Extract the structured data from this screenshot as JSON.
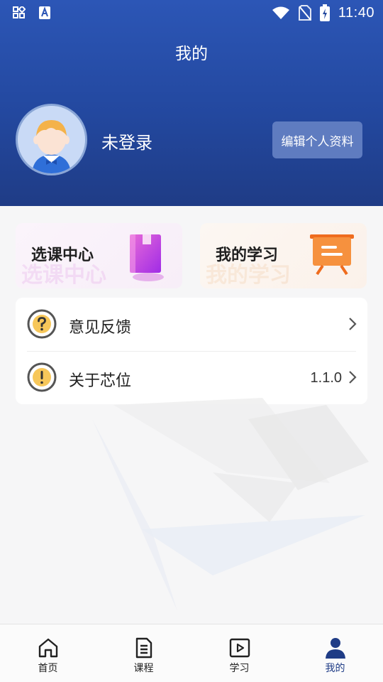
{
  "status_bar": {
    "time": "11:40",
    "left_icons": [
      "grid-icon",
      "a-app-icon"
    ],
    "right_icons": [
      "wifi-icon",
      "no-sim-icon",
      "battery-charging-icon"
    ]
  },
  "header": {
    "title": "我的",
    "background_color": "#23489f"
  },
  "profile": {
    "username": "未登录",
    "edit_button_label": "编辑个人资料"
  },
  "quick_cards": [
    {
      "label": "选课中心",
      "icon": "book-icon",
      "accent": "#c63ed3"
    },
    {
      "label": "我的学习",
      "icon": "presentation-board-icon",
      "accent": "#f07a2a"
    }
  ],
  "menu": {
    "items": [
      {
        "label": "意见反馈",
        "icon": "question-circle-icon",
        "value": ""
      },
      {
        "label": "关于芯位",
        "icon": "exclamation-circle-icon",
        "value": "1.1.0"
      }
    ]
  },
  "tab_bar": {
    "tabs": [
      {
        "label": "首页",
        "icon": "home-icon",
        "active": false
      },
      {
        "label": "课程",
        "icon": "document-icon",
        "active": false
      },
      {
        "label": "学习",
        "icon": "play-icon",
        "active": false
      },
      {
        "label": "我的",
        "icon": "user-icon",
        "active": true
      }
    ],
    "active_color": "#1f3c86"
  }
}
